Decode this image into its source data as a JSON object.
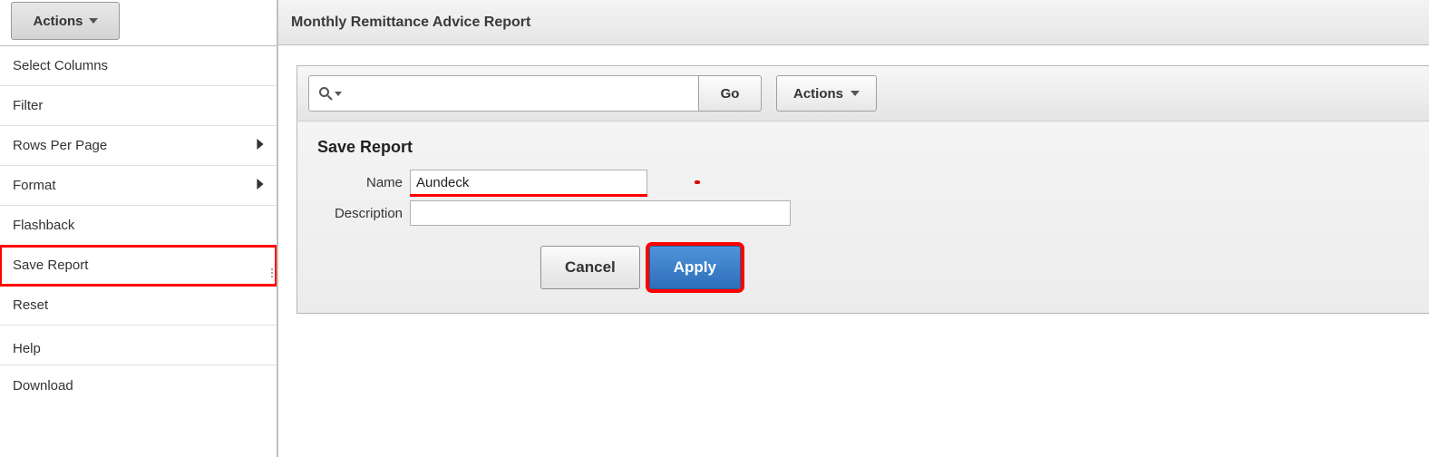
{
  "sidebar": {
    "actions_label": "Actions",
    "items": [
      {
        "label": "Select Columns",
        "has_submenu": false
      },
      {
        "label": "Filter",
        "has_submenu": false
      },
      {
        "label": "Rows Per Page",
        "has_submenu": true
      },
      {
        "label": "Format",
        "has_submenu": true
      },
      {
        "label": "Flashback",
        "has_submenu": false
      },
      {
        "label": "Save Report",
        "has_submenu": false,
        "highlighted": true
      },
      {
        "label": "Reset",
        "has_submenu": false
      },
      {
        "label": "Help",
        "has_submenu": false
      },
      {
        "label": "Download",
        "has_submenu": false
      }
    ]
  },
  "page": {
    "title": "Monthly Remittance Advice Report"
  },
  "toolbar": {
    "search_value": "",
    "go_label": "Go",
    "actions_label": "Actions"
  },
  "save_report": {
    "panel_title": "Save Report",
    "name_label": "Name",
    "name_value": "Aundeck",
    "description_label": "Description",
    "description_value": "",
    "cancel_label": "Cancel",
    "apply_label": "Apply"
  }
}
